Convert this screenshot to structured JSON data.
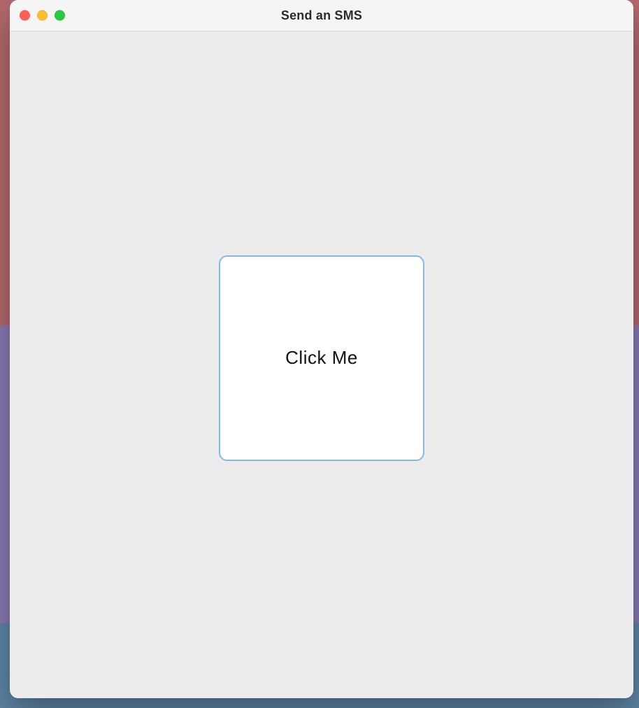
{
  "window": {
    "title": "Send an SMS"
  },
  "main": {
    "button_label": "Click Me"
  }
}
